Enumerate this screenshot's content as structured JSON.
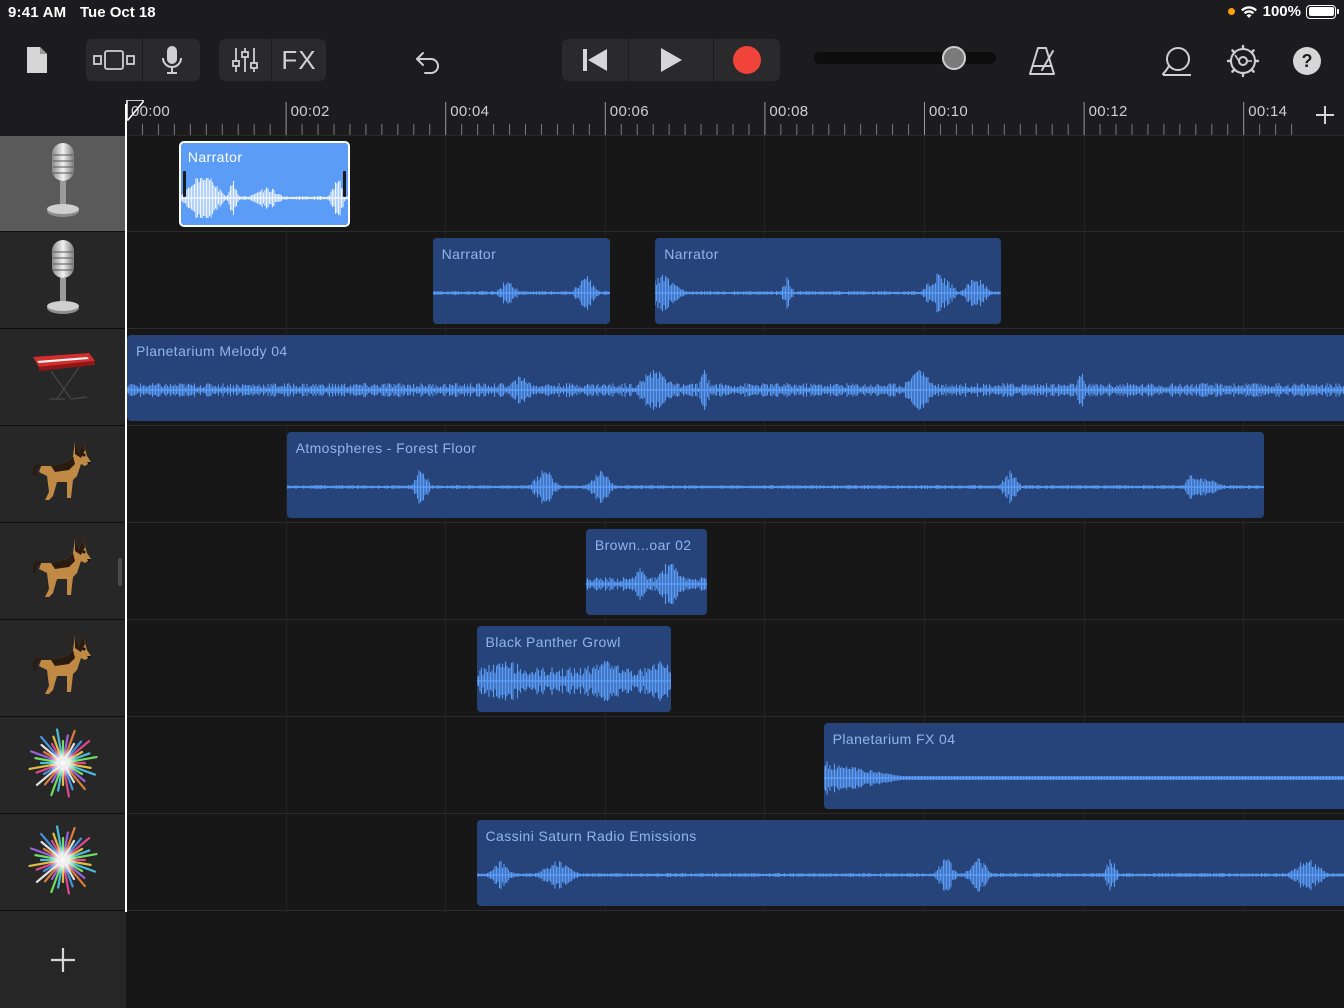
{
  "status_bar": {
    "time": "9:41 AM",
    "date": "Tue Oct 18",
    "battery": "100%",
    "indicator_color": "#ff9f0a"
  },
  "toolbar": {
    "fx_label": "FX",
    "master_volume": 0.77,
    "icons": [
      "document-icon",
      "tracks-view-icon",
      "microphone-icon",
      "mixer-icon",
      "fx-icon",
      "undo-icon",
      "go-to-beginning-icon",
      "play-icon",
      "record-icon",
      "metronome-icon",
      "loop-browser-icon",
      "settings-icon",
      "help-icon"
    ]
  },
  "ruler": {
    "labels": [
      "00:00",
      "00:02",
      "00:04",
      "00:06",
      "00:08",
      "00:10",
      "00:12",
      "00:14"
    ]
  },
  "tracks": [
    {
      "instrument": "microphone-icon",
      "selected": true
    },
    {
      "instrument": "microphone-icon",
      "selected": false
    },
    {
      "instrument": "keyboard-icon",
      "selected": false
    },
    {
      "instrument": "dog-icon",
      "selected": false
    },
    {
      "instrument": "dog-icon",
      "selected": false
    },
    {
      "instrument": "dog-icon",
      "selected": false
    },
    {
      "instrument": "sparkle-icon",
      "selected": false
    },
    {
      "instrument": "sparkle-icon",
      "selected": false
    }
  ],
  "regions": [
    {
      "title": "Narrator",
      "track": 0,
      "start_sec": 0.65,
      "end_sec": 2.8,
      "selected": true
    },
    {
      "title": "Narrator",
      "track": 1,
      "start_sec": 3.83,
      "end_sec": 6.05,
      "selected": false
    },
    {
      "title": "Narrator",
      "track": 1,
      "start_sec": 6.62,
      "end_sec": 10.95,
      "selected": false
    },
    {
      "title": "Planetarium Melody 04",
      "track": 2,
      "start_sec": 0.0,
      "end_sec": 15.3,
      "selected": false
    },
    {
      "title": "Atmospheres - Forest Floor",
      "track": 3,
      "start_sec": 2.0,
      "end_sec": 14.25,
      "selected": false
    },
    {
      "title": "Brown...oar 02",
      "track": 4,
      "start_sec": 5.75,
      "end_sec": 7.27,
      "selected": false
    },
    {
      "title": "Black Panther Growl",
      "track": 5,
      "start_sec": 4.38,
      "end_sec": 6.82,
      "selected": false
    },
    {
      "title": "Planetarium FX 04",
      "track": 6,
      "start_sec": 8.73,
      "end_sec": 15.3,
      "selected": false
    },
    {
      "title": "Cassini Saturn Radio Emissions",
      "track": 7,
      "start_sec": 4.38,
      "end_sec": 15.3,
      "selected": false
    }
  ],
  "colors": {
    "region": "#26447a",
    "region_selected": "#5b9cf6",
    "waveform": "#5b9cf6",
    "record": "#f0433a"
  }
}
